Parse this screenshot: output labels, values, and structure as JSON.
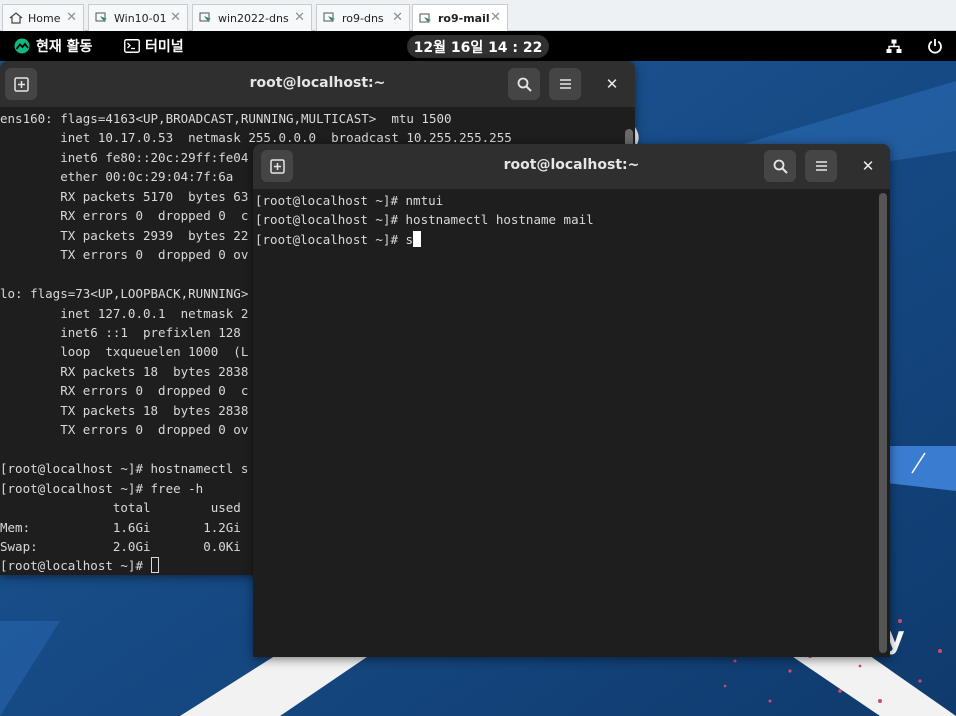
{
  "vm_tabs": [
    {
      "label": "Home",
      "icon": "home-icon"
    },
    {
      "label": "Win10-01",
      "icon": "vm-icon"
    },
    {
      "label": "win2022-dns",
      "icon": "vm-icon"
    },
    {
      "label": "ro9-dns",
      "icon": "vm-icon"
    },
    {
      "label": "ro9-mail",
      "icon": "vm-icon",
      "active": true
    }
  ],
  "topbar": {
    "activities": "현재 활동",
    "app_name": "터미널",
    "clock": "12월 16일 14 : 22"
  },
  "terminal_back": {
    "title": "root@localhost:~",
    "lines": [
      "ens160: flags=4163<UP,BROADCAST,RUNNING,MULTICAST>  mtu 1500",
      "        inet 10.17.0.53  netmask 255.0.0.0  broadcast 10.255.255.255",
      "        inet6 fe80::20c:29ff:fe04",
      "        ether 00:0c:29:04:7f:6a",
      "        RX packets 5170  bytes 63",
      "        RX errors 0  dropped 0  c",
      "        TX packets 2939  bytes 22",
      "        TX errors 0  dropped 0 ov",
      "",
      "lo: flags=73<UP,LOOPBACK,RUNNING>",
      "        inet 127.0.0.1  netmask 2",
      "        inet6 ::1  prefixlen 128",
      "        loop  txqueuelen 1000  (L",
      "        RX packets 18  bytes 2838",
      "        RX errors 0  dropped 0  c",
      "        TX packets 18  bytes 2838",
      "        TX errors 0  dropped 0 ov",
      "",
      "[root@localhost ~]# hostnamectl s",
      "[root@localhost ~]# free -h",
      "               total        used",
      "Mem:           1.6Gi       1.2Gi",
      "Swap:          2.0Gi       0.0Ki",
      "[root@localhost ~]# "
    ]
  },
  "terminal_front": {
    "title": "root@localhost:~",
    "lines": [
      "[root@localhost ~]# nmtui",
      "[root@localhost ~]# hostnamectl hostname mail",
      "[root@localhost ~]# s"
    ]
  },
  "desktop": {
    "corner_text": "y"
  },
  "colors": {
    "terminal_bg": "#1e1e1e",
    "header_bg": "#2f2f2f",
    "desktop_bg": "#1a4e88",
    "rocky_green": "#10b981"
  }
}
